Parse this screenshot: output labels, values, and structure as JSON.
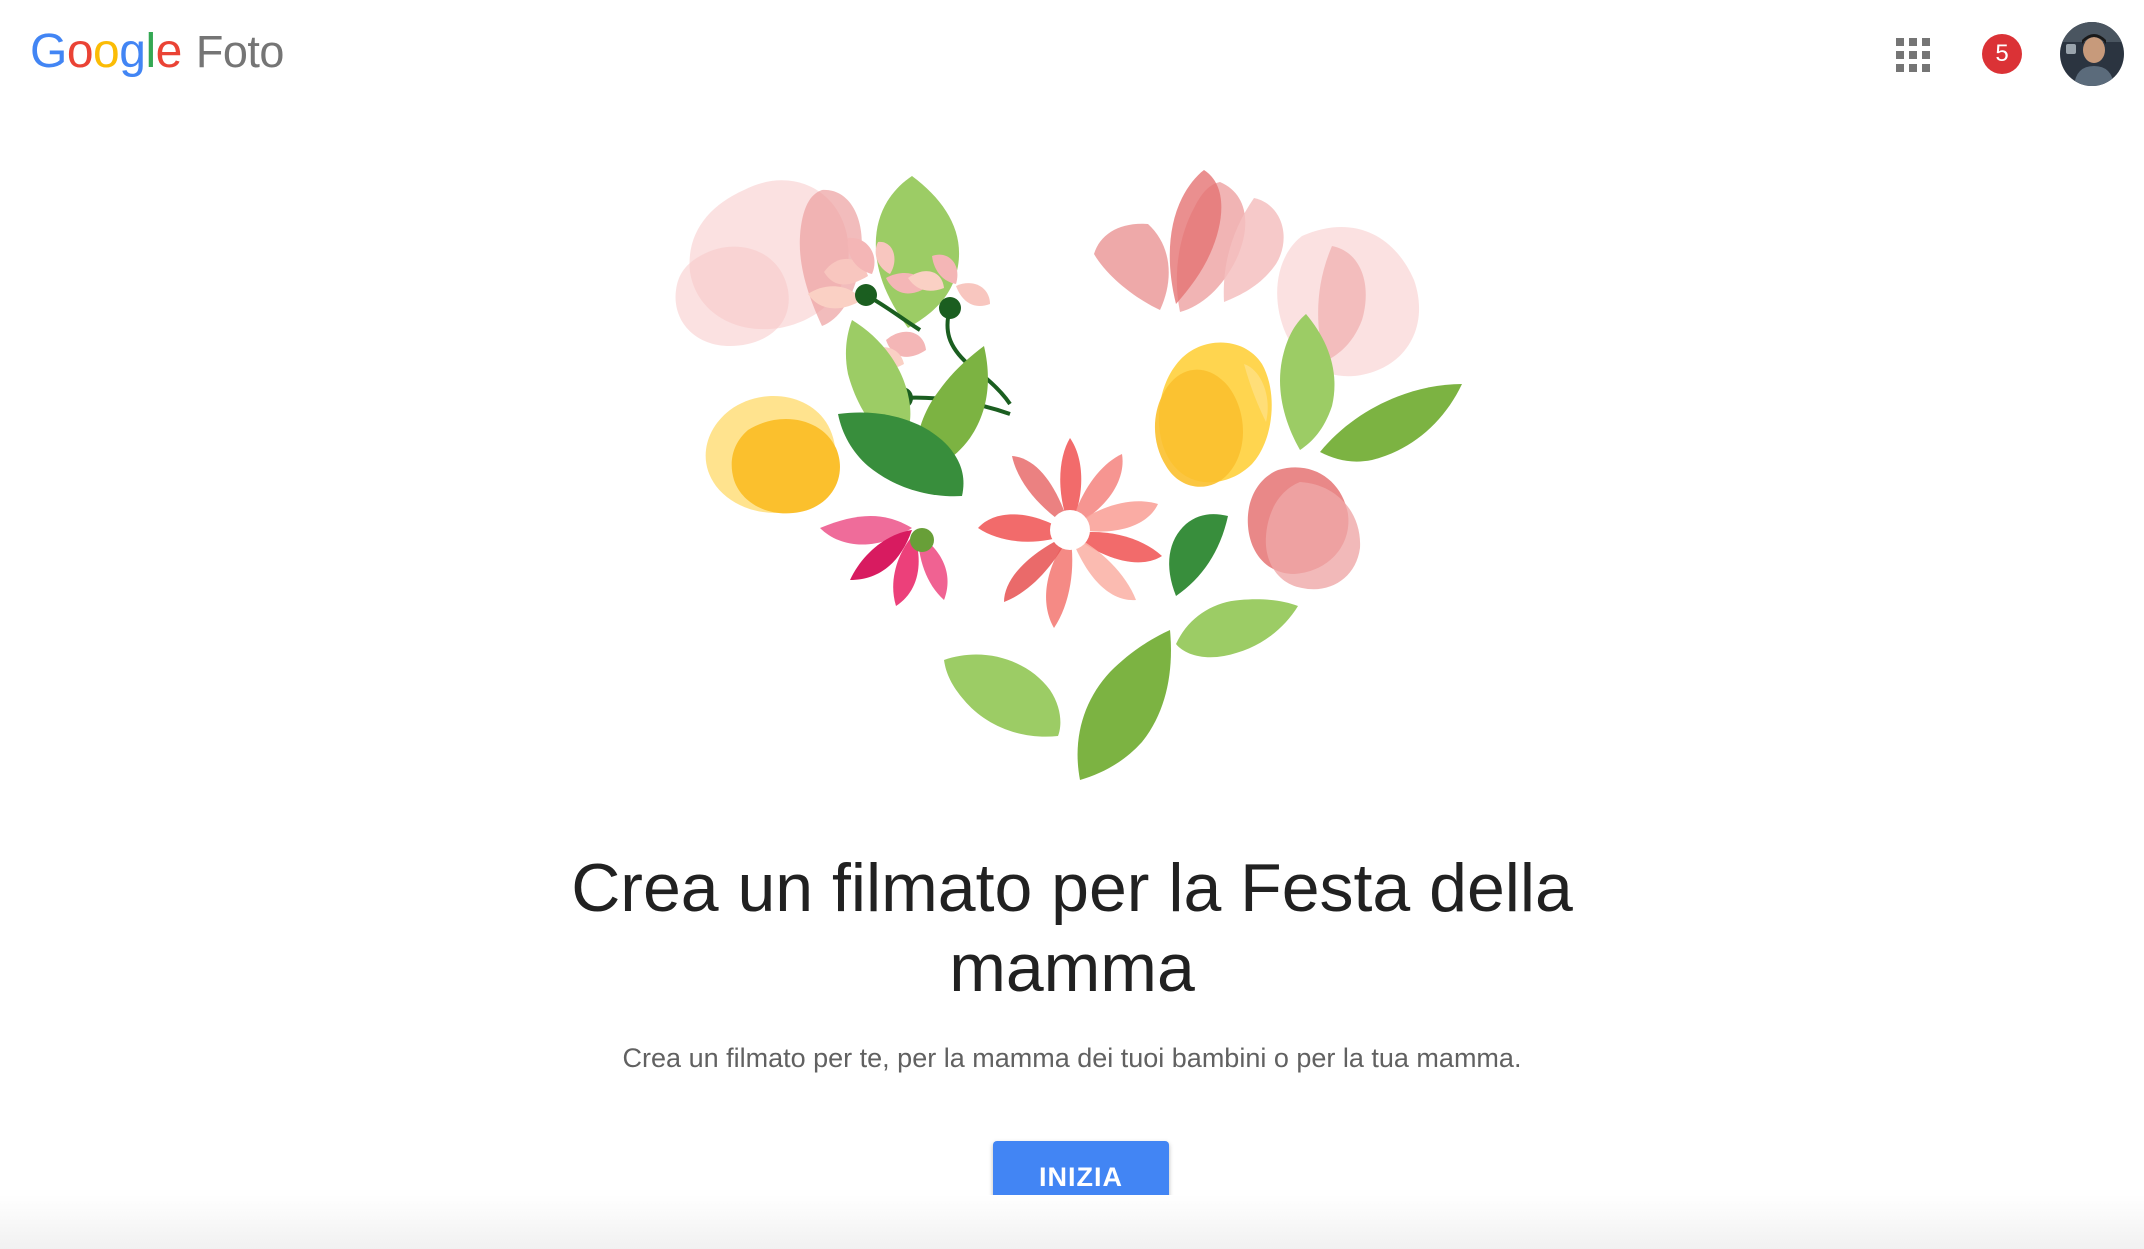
{
  "header": {
    "logo_letters": [
      "G",
      "o",
      "o",
      "g",
      "l",
      "e"
    ],
    "product_name": "Foto",
    "apps_icon": "apps-grid-icon",
    "notifications_count": "5",
    "avatar_icon": "user-avatar"
  },
  "hero": {
    "illustration": "flower-heart-illustration",
    "title": "Crea un filmato per la Festa della mamma",
    "subtitle": "Crea un filmato per te, per la mamma dei tuoi bambini o per la tua mamma.",
    "cta_label": "INIZIA"
  },
  "colors": {
    "primary_button": "#4285F4",
    "badge": "#DB3236",
    "title_text": "#212121",
    "subtitle_text": "#616161",
    "logo_blue": "#4285F4",
    "logo_red": "#EA4335",
    "logo_yellow": "#FBBC05",
    "logo_green": "#34A853"
  }
}
